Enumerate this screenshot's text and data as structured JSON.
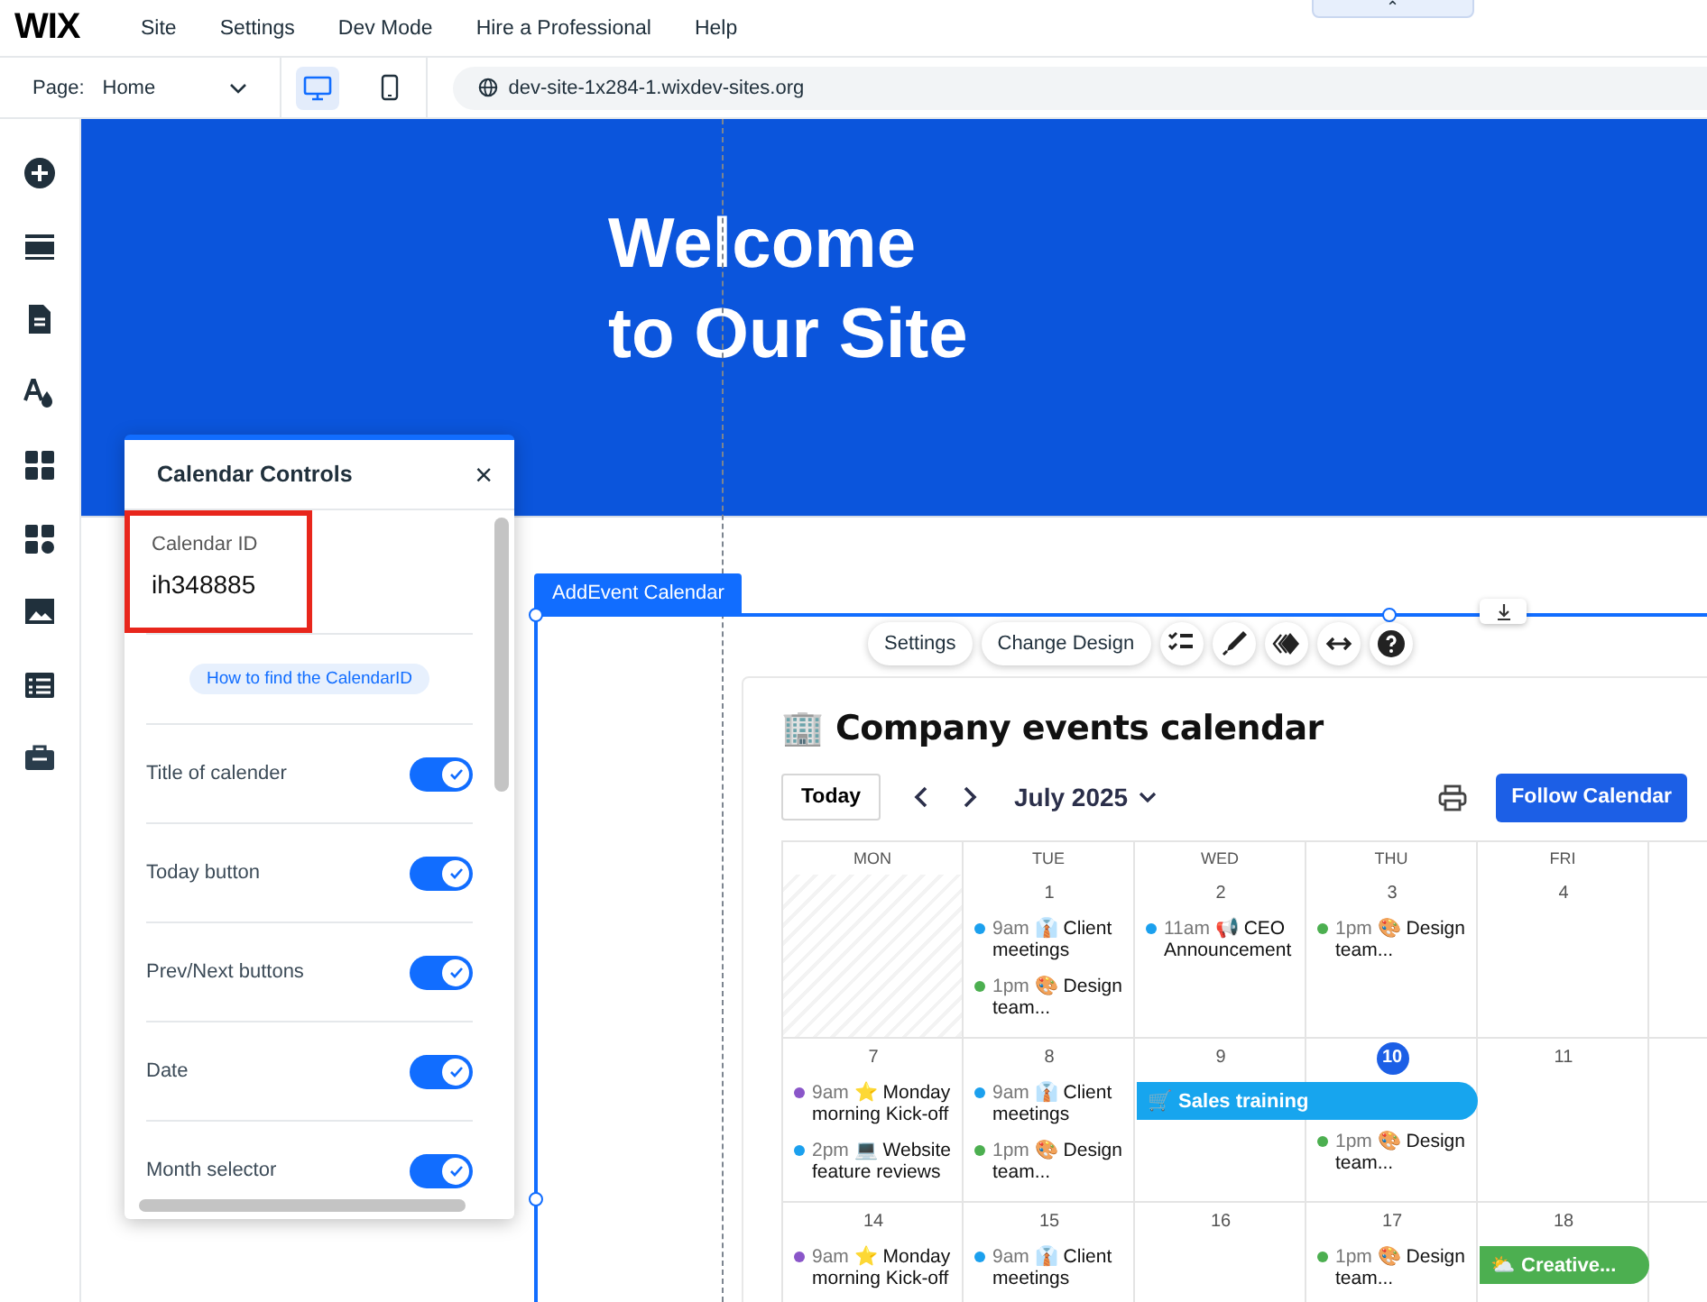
{
  "top_bar": {
    "logo": "WIX",
    "menu": [
      "Site",
      "Settings",
      "Dev Mode",
      "Hire a Professional",
      "Help"
    ],
    "collapse_tab": "⌃"
  },
  "page_bar": {
    "page_label": "Page:",
    "page_value": "Home",
    "devices": [
      {
        "kind": "desktop",
        "selected": true
      },
      {
        "kind": "mobile",
        "selected": false
      }
    ],
    "url": "dev-site-1x284-1.wixdev-sites.org"
  },
  "hero": {
    "lines": [
      "Welcome",
      "to Our Site"
    ]
  },
  "widget": {
    "label": "AddEvent Calendar",
    "toolbar_buttons": [
      "Settings",
      "Change Design"
    ]
  },
  "calendar": {
    "title": "🏢 Company events calendar",
    "today_button": "Today",
    "month": "July 2025",
    "follow_button": "Follow Calendar",
    "columns": [
      "MON",
      "TUE",
      "WED",
      "THU",
      "FRI"
    ],
    "weeks": [
      {
        "days": [
          {
            "outside_month": true
          },
          {
            "date": "1",
            "outside_month": false,
            "today": false,
            "events": [
              {
                "kind": "dot",
                "time": "9am",
                "title": "👔 Client meetings",
                "color": "#1ba0ee"
              },
              {
                "kind": "dot",
                "time": "1pm",
                "title": "🎨 Design team...",
                "color": "#4caf50"
              }
            ]
          },
          {
            "date": "2",
            "outside_month": false,
            "today": false,
            "events": [
              {
                "kind": "dot",
                "time": "11am",
                "title": "📢 CEO Announcement",
                "color": "#1ba0ee"
              }
            ]
          },
          {
            "date": "3",
            "outside_month": false,
            "today": false,
            "events": [
              {
                "kind": "dot",
                "time": "1pm",
                "title": "🎨 Design team...",
                "color": "#4caf50"
              }
            ]
          },
          {
            "date": "4",
            "outside_month": false,
            "today": false
          }
        ]
      },
      {
        "days": [
          {
            "date": "7",
            "outside_month": false,
            "today": false,
            "events": [
              {
                "kind": "dot",
                "time": "9am",
                "title": "⭐ Monday morning Kick-off",
                "color": "#8a56c9"
              },
              {
                "kind": "dot",
                "time": "2pm",
                "title": "💻 Website feature reviews",
                "color": "#1ba0ee"
              }
            ]
          },
          {
            "date": "8",
            "outside_month": false,
            "today": false,
            "events": [
              {
                "kind": "dot",
                "time": "9am",
                "title": "👔 Client meetings",
                "color": "#1ba0ee"
              },
              {
                "kind": "dot",
                "time": "1pm",
                "title": "🎨 Design team...",
                "color": "#4caf50"
              }
            ]
          },
          {
            "date": "9",
            "outside_month": false,
            "today": false,
            "events": [
              {
                "kind": "bar",
                "wide": true,
                "title": "🛒 Sales training",
                "color": "#17a5ee"
              }
            ]
          },
          {
            "date": "10",
            "outside_month": false,
            "today": true,
            "events": [
              {
                "kind": "dot",
                "time": "1pm",
                "title": "🎨 Design team...",
                "color": "#4caf50"
              }
            ]
          },
          {
            "date": "11",
            "outside_month": false,
            "today": false
          }
        ]
      },
      {
        "days": [
          {
            "date": "14",
            "outside_month": false,
            "today": false,
            "events": [
              {
                "kind": "dot",
                "time": "9am",
                "title": "⭐ Monday morning Kick-off",
                "color": "#8a56c9"
              }
            ]
          },
          {
            "date": "15",
            "outside_month": false,
            "today": false,
            "events": [
              {
                "kind": "dot",
                "time": "9am",
                "title": "👔 Client meetings",
                "color": "#1ba0ee"
              }
            ]
          },
          {
            "date": "16",
            "outside_month": false,
            "today": false
          },
          {
            "date": "17",
            "outside_month": false,
            "today": false,
            "events": [
              {
                "kind": "dot",
                "time": "1pm",
                "title": "🎨 Design team...",
                "color": "#4caf50"
              }
            ]
          },
          {
            "date": "18",
            "outside_month": false,
            "today": false,
            "events": [
              {
                "kind": "bar",
                "wide": false,
                "title": "⛅ Creative...",
                "color": "#4caf50"
              }
            ]
          }
        ]
      }
    ]
  },
  "panel": {
    "title": "Calendar Controls",
    "close": "×",
    "id_field": {
      "label": "Calendar ID",
      "value": "ih348885",
      "highlighted": true
    },
    "help_link": "How to find the CalendarID",
    "toggles": [
      {
        "label": "Title of calender",
        "on": true
      },
      {
        "label": "Today button",
        "on": true
      },
      {
        "label": "Prev/Next buttons",
        "on": true
      },
      {
        "label": "Date",
        "on": true
      },
      {
        "label": "Month selector",
        "on": true
      }
    ]
  }
}
